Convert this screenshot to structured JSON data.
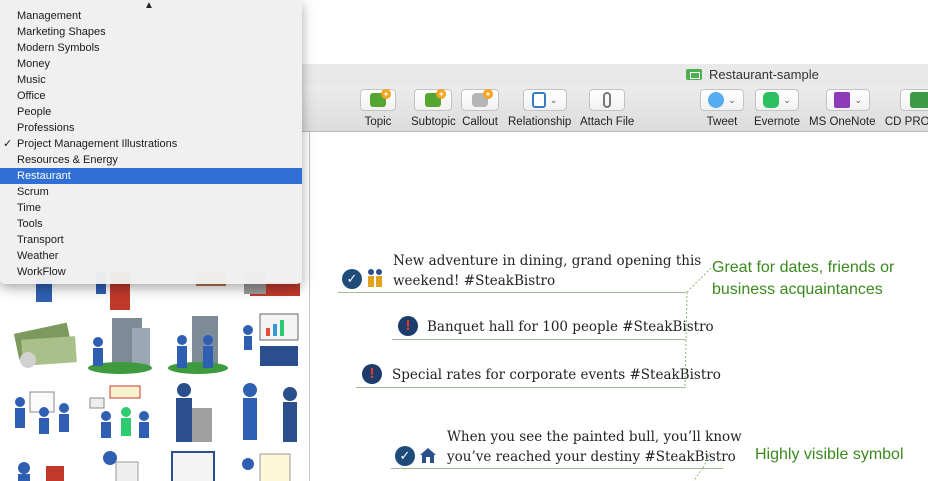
{
  "window": {
    "title": "Restaurant-sample"
  },
  "toolbar": {
    "items": [
      {
        "label": "Topic"
      },
      {
        "label": "Subtopic"
      },
      {
        "label": "Callout"
      },
      {
        "label": "Relationship"
      },
      {
        "label": "Attach File"
      },
      {
        "label": "Tweet"
      },
      {
        "label": "Evernote"
      },
      {
        "label": "MS OneNote"
      },
      {
        "label": "CD PRO..."
      }
    ]
  },
  "dropdown": {
    "selected": "Restaurant",
    "checked": "Project Management Illustrations",
    "items": [
      "Management",
      "Marketing Shapes",
      "Modern Symbols",
      "Money",
      "Music",
      "Office",
      "People",
      "Professions",
      "Project Management Illustrations",
      "Resources & Energy",
      "Restaurant",
      "Scrum",
      "Time",
      "Tools",
      "Transport",
      "Weather",
      "WorkFlow"
    ]
  },
  "mindmap": {
    "topics": [
      {
        "text_line1": "New adventure in dining, grand opening this",
        "text_line2": "weekend! #SteakBistro"
      },
      {
        "text": "Banquet hall for 100 people #SteakBistro"
      },
      {
        "text": "Special rates for corporate events #SteakBistro"
      },
      {
        "text_line1": "When you see the painted bull, you’ll know",
        "text_line2": "you’ve reached your destiny #SteakBistro"
      }
    ],
    "callouts": [
      {
        "line1": "Great for dates, friends or",
        "line2": "business acquaintances"
      },
      {
        "line1": "Highly visible symbol"
      }
    ]
  },
  "colors": {
    "selection": "#2f6fd6",
    "callout_text": "#3a8a1e",
    "branch_line": "#9dbd8a"
  }
}
